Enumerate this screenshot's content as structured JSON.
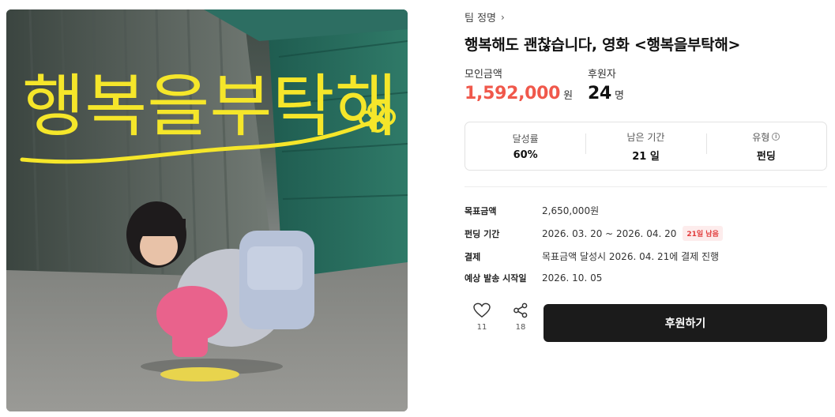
{
  "poster": {
    "title_art": "행복을부탁해"
  },
  "project": {
    "team": "팀 정명",
    "title": "행복해도 괜찮습니다, 영화 <행복을부탁해>"
  },
  "stats": {
    "amount_label": "모인금액",
    "amount": "1,592,000",
    "amount_unit": "원",
    "backers_label": "후원자",
    "backers": "24",
    "backers_unit": "명"
  },
  "summary": {
    "rate_label": "달성률",
    "rate": "60%",
    "remaining_label": "남은 기간",
    "remaining": "21 일",
    "type_label": "유형",
    "type": "펀딩"
  },
  "details": {
    "goal_label": "목표금액",
    "goal": "2,650,000원",
    "period_label": "펀딩 기간",
    "period": "2026. 03. 20 ~ 2026. 04. 20",
    "period_badge": "21일 남음",
    "payment_label": "결제",
    "payment": "목표금액 달성시 2026. 04. 21에 결제 진행",
    "delivery_label": "예상 발송 시작일",
    "delivery": "2026. 10. 05"
  },
  "actions": {
    "likes": "11",
    "shares": "18",
    "back_label": "후원하기"
  },
  "colors": {
    "accent": "#f0584b",
    "cta": "#1b1b1b",
    "poster_text": "#f5e62a"
  }
}
